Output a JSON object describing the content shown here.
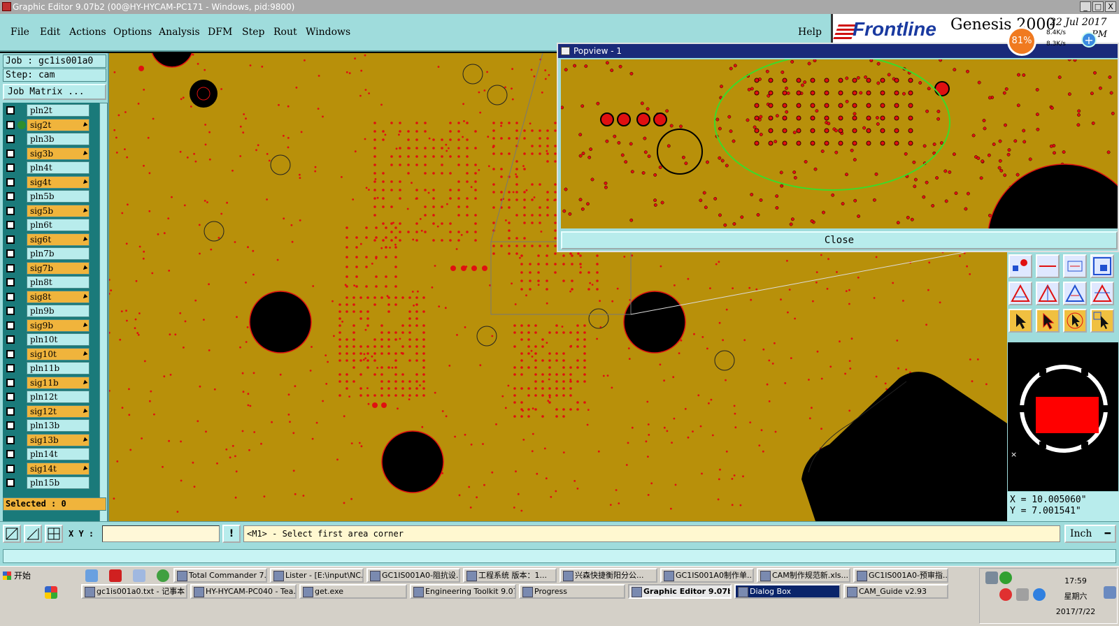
{
  "window": {
    "title": "Graphic Editor 9.07b2 (00@HY-HYCAM-PC171 - Windows, pid:9800)",
    "minimize": "_",
    "maximize": "□",
    "close": "X"
  },
  "menu": {
    "items": [
      "File",
      "Edit",
      "Actions",
      "Options",
      "Analysis",
      "DFM",
      "Step",
      "Rout",
      "Windows"
    ],
    "help": "Help"
  },
  "brand": {
    "logo": "Frontline",
    "product": "Genesis 2000",
    "date": "22 Jul 2017",
    "time": "PM"
  },
  "netwidget": {
    "percent": "81%",
    "up": "8.4K/s",
    "down": "8.3K/s",
    "plus": "+"
  },
  "job": {
    "job_line": "Job : gc1is001a0",
    "step_line": "Step: cam",
    "matrix_button": "Job Matrix ...",
    "selected": "Selected : 0"
  },
  "layers": [
    {
      "name": "pln2t",
      "kind": "pln"
    },
    {
      "name": "sig2t",
      "kind": "sig",
      "active": true
    },
    {
      "name": "pln3b",
      "kind": "pln"
    },
    {
      "name": "sig3b",
      "kind": "sig"
    },
    {
      "name": "pln4t",
      "kind": "pln"
    },
    {
      "name": "sig4t",
      "kind": "sig"
    },
    {
      "name": "pln5b",
      "kind": "pln"
    },
    {
      "name": "sig5b",
      "kind": "sig"
    },
    {
      "name": "pln6t",
      "kind": "pln"
    },
    {
      "name": "sig6t",
      "kind": "sig"
    },
    {
      "name": "pln7b",
      "kind": "pln"
    },
    {
      "name": "sig7b",
      "kind": "sig"
    },
    {
      "name": "pln8t",
      "kind": "pln"
    },
    {
      "name": "sig8t",
      "kind": "sig"
    },
    {
      "name": "pln9b",
      "kind": "pln"
    },
    {
      "name": "sig9b",
      "kind": "sig"
    },
    {
      "name": "pln10t",
      "kind": "pln"
    },
    {
      "name": "sig10t",
      "kind": "sig"
    },
    {
      "name": "pln11b",
      "kind": "pln"
    },
    {
      "name": "sig11b",
      "kind": "sig"
    },
    {
      "name": "pln12t",
      "kind": "pln"
    },
    {
      "name": "sig12t",
      "kind": "sig"
    },
    {
      "name": "pln13b",
      "kind": "pln"
    },
    {
      "name": "sig13b",
      "kind": "sig"
    },
    {
      "name": "pln14t",
      "kind": "pln"
    },
    {
      "name": "sig14t",
      "kind": "sig"
    },
    {
      "name": "pln15b",
      "kind": "pln"
    }
  ],
  "popview": {
    "title": "Popview - 1",
    "close_label": "Close"
  },
  "coords": {
    "x": "X = 10.005060\"",
    "y": "Y =  7.001541\""
  },
  "status": {
    "xy_label": "X Y :",
    "xy_value": "",
    "message": "<M1> - Select first area corner",
    "units": "Inch",
    "alert": "!"
  },
  "taskbar": {
    "start": "开始",
    "row1": [
      "Total Commander 7....",
      "Lister - [E:\\input\\NC...",
      "GC1IS001A0-阻抗设...",
      "工程系统  版本：1...",
      "兴森快捷衡阳分公...",
      "GC1IS001A0制作单...",
      "CAM制作规范新.xls...",
      "GC1IS001A0-预审指..."
    ],
    "row2": [
      "gc1is001a0.txt - 记事本",
      "HY-HYCAM-PC040 - Tea...",
      "get.exe",
      "Engineering Toolkit 9.07...",
      "Progress",
      "Graphic Editor 9.07b2...",
      "Dialog Box",
      "CAM_Guide v2.93"
    ],
    "clock_time": "17:59",
    "clock_day": "星期六",
    "clock_date": "2017/7/22"
  },
  "colors": {
    "board": "#b8900a",
    "pad": "#e01010",
    "panel": "#9fdcdc",
    "signal_layer": "#f0b43c",
    "highlight_ellipse": "#3adc2a"
  }
}
